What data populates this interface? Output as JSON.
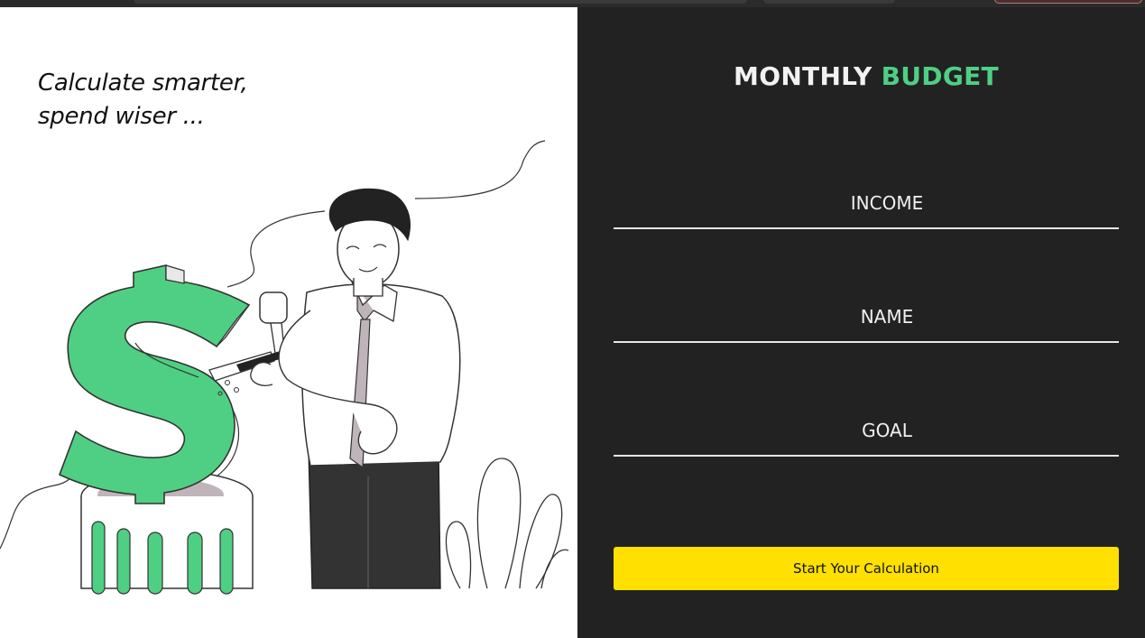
{
  "hero": {
    "tagline_line1": "Calculate smarter,",
    "tagline_line2": "spend wiser ..."
  },
  "form": {
    "title_main": "MONTHLY",
    "title_accent": "BUDGET",
    "fields": [
      {
        "placeholder": "INCOME",
        "value": ""
      },
      {
        "placeholder": "NAME",
        "value": ""
      },
      {
        "placeholder": "GOAL",
        "value": ""
      }
    ],
    "submit_label": "Start Your Calculation"
  },
  "colors": {
    "panel_bg": "#222222",
    "accent_green": "#4fcf83",
    "button_yellow": "#ffe000"
  }
}
